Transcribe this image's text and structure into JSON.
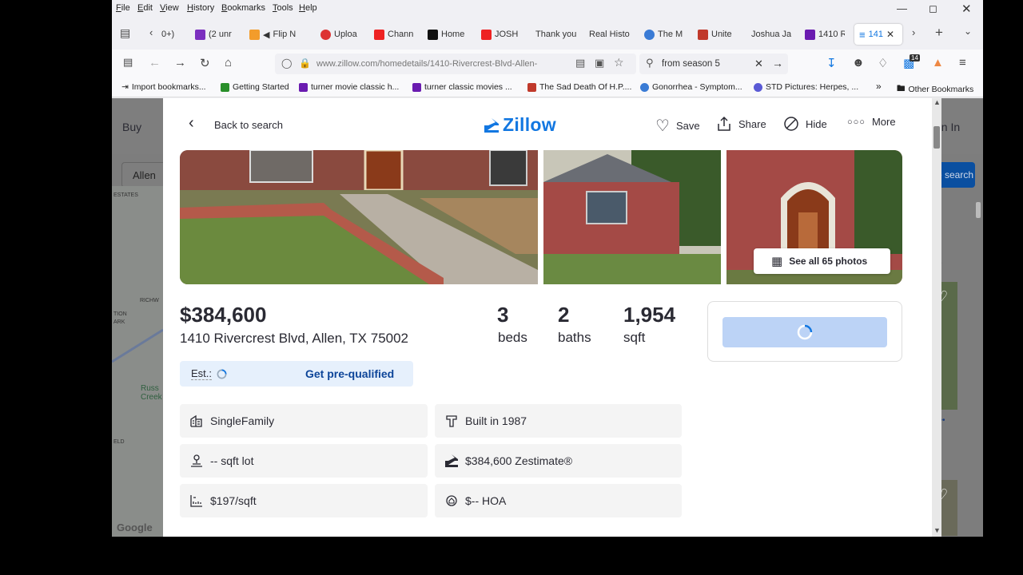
{
  "menu": [
    "File",
    "Edit",
    "View",
    "History",
    "Bookmarks",
    "Tools",
    "Help"
  ],
  "tabs": [
    {
      "label": "0+)",
      "color": "#888888"
    },
    {
      "label": "(2 unr",
      "color": "#7b2fbf"
    },
    {
      "label": "Flip N",
      "color": "#f39c2b"
    },
    {
      "label": "Uploa",
      "color": "#d33"
    },
    {
      "label": "Chann",
      "color": "#e22"
    },
    {
      "label": "Home",
      "color": "#111"
    },
    {
      "label": "JOSH",
      "color": "#e22"
    },
    {
      "label": "Thank you",
      "color": "#ffffff"
    },
    {
      "label": "Real Histo",
      "color": "#ffffff"
    },
    {
      "label": "The M",
      "color": "#3a7bd5"
    },
    {
      "label": "Unite",
      "color": "#c0392b"
    },
    {
      "label": "Joshua Jal",
      "color": "#ffffff"
    },
    {
      "label": "1410 R",
      "color": "#6a1bb0"
    },
    {
      "label": "141",
      "color": "#1277e1"
    }
  ],
  "url": "www.zillow.com/homedetails/1410-Rivercrest-Blvd-Allen-",
  "search_text": "from season 5",
  "badge_count": "14",
  "bookmarks": [
    {
      "label": "Import bookmarks...",
      "color": "#777"
    },
    {
      "label": "Getting Started",
      "color": "#2a8f2a"
    },
    {
      "label": "turner movie classic h...",
      "color": "#6a1bb0"
    },
    {
      "label": "turner classic movies ...",
      "color": "#6a1bb0"
    },
    {
      "label": "The Sad Death Of H.P....",
      "color": "#c0392b"
    },
    {
      "label": "Gonorrhea - Symptom...",
      "color": "#3a7bd5"
    },
    {
      "label": "STD Pictures: Herpes, ...",
      "color": "#5a5ad5"
    },
    {
      "label": "Other Bookmarks",
      "color": "#777"
    }
  ],
  "bg": {
    "buy": "Buy",
    "allen": "Allen",
    "estates": "ESTATES",
    "richw": "RICHW",
    "tion": "TION",
    "ark": "ARK",
    "russ_creek": "Russ Creek",
    "eld": "ELD",
    "google": "Google",
    "sign_in": "gn In",
    "save_search": "e search"
  },
  "modal": {
    "back": "Back to search",
    "logo": "Zillow",
    "save": "Save",
    "share": "Share",
    "hide": "Hide",
    "more": "More",
    "see_all": "See all 65 photos",
    "price": "$384,600",
    "address": "1410 Rivercrest Blvd, Allen, TX 75002",
    "beds_num": "3",
    "beds_lbl": "beds",
    "baths_num": "2",
    "baths_lbl": "baths",
    "sqft_num": "1,954",
    "sqft_lbl": "sqft",
    "est": "Est.:",
    "prequal": "Get pre-qualified",
    "facts": [
      {
        "label": "SingleFamily",
        "icon": "home-type-icon"
      },
      {
        "label": "Built in 1987",
        "icon": "hammer-icon"
      },
      {
        "label": "-- sqft lot",
        "icon": "lot-icon"
      },
      {
        "label": "$384,600 Zestimate®",
        "icon": "zestimate-icon"
      },
      {
        "label": "$197/sqft",
        "icon": "ruler-icon"
      },
      {
        "label": "$-- HOA",
        "icon": "hoa-icon"
      }
    ]
  }
}
